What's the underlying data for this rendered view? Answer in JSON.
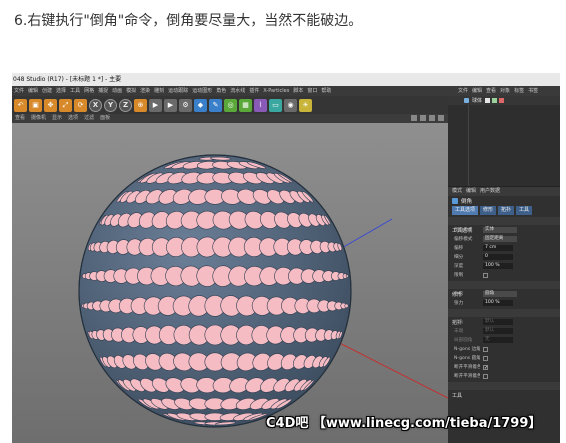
{
  "caption": "6.右键执行\"倒角\"命令，倒角要尽量大，当然不能破边。",
  "window": {
    "title": "048 Studio (R17) - [未标题 1 *] - 主要"
  },
  "menubar": [
    "文件",
    "编辑",
    "创建",
    "选择",
    "工具",
    "网格",
    "捕捉",
    "动画",
    "模拟",
    "渲染",
    "雕刻",
    "运动跟踪",
    "运动图形",
    "角色",
    "流水线",
    "插件",
    "X-Particles",
    "脚本",
    "窗口",
    "帮助"
  ],
  "toolbar": [
    {
      "icon": "undo-icon",
      "glyph": "↶",
      "color": "orange"
    },
    {
      "icon": "live-selection-icon",
      "glyph": "▣",
      "color": "orange"
    },
    {
      "icon": "move-icon",
      "glyph": "✥",
      "color": "orange"
    },
    {
      "icon": "scale-icon",
      "glyph": "⤢",
      "color": "orange"
    },
    {
      "icon": "rotate-icon",
      "glyph": "⟳",
      "color": "orange"
    },
    {
      "icon": "x-axis-icon",
      "glyph": "X",
      "color": "axis"
    },
    {
      "icon": "y-axis-icon",
      "glyph": "Y",
      "color": "axis"
    },
    {
      "icon": "z-axis-icon",
      "glyph": "Z",
      "color": "axis"
    },
    {
      "icon": "coordinate-system-icon",
      "glyph": "⊕",
      "color": "orange"
    },
    {
      "icon": "render-view-icon",
      "glyph": "▶",
      "color": "grey"
    },
    {
      "icon": "render-picture-viewer-icon",
      "glyph": "▶",
      "color": "grey"
    },
    {
      "icon": "render-settings-icon",
      "glyph": "⚙",
      "color": "grey"
    },
    {
      "icon": "cube-icon",
      "glyph": "◆",
      "color": "blue"
    },
    {
      "icon": "pen-icon",
      "glyph": "✎",
      "color": "blue"
    },
    {
      "icon": "subdivision-icon",
      "glyph": "◎",
      "color": "green"
    },
    {
      "icon": "array-icon",
      "glyph": "▦",
      "color": "green"
    },
    {
      "icon": "deformer-icon",
      "glyph": "⌇",
      "color": "purple"
    },
    {
      "icon": "floor-icon",
      "glyph": "▭",
      "color": "teal"
    },
    {
      "icon": "camera-icon",
      "glyph": "◉",
      "color": "grey"
    },
    {
      "icon": "light-icon",
      "glyph": "☀",
      "color": "yellow"
    }
  ],
  "viewport": {
    "menu": [
      "查看",
      "摄像机",
      "显示",
      "选项",
      "过滤",
      "面板"
    ]
  },
  "object_manager": {
    "tabs": [
      "文件",
      "编辑",
      "查看",
      "对象",
      "标签",
      "书签"
    ],
    "object_name": "球体"
  },
  "attributes": {
    "tabs": [
      "模式",
      "编辑",
      "用户数据"
    ],
    "title": "倒角",
    "subtabs": [
      "工具选项",
      "修形",
      "拓扑",
      "工具"
    ],
    "section_tool_options": "工具选项",
    "rows_tool": [
      {
        "label": "倒角模式",
        "value": "实体"
      },
      {
        "label": "偏移模式",
        "value": "固定距离"
      },
      {
        "label": "偏移",
        "value": "7 cm"
      },
      {
        "label": "细分",
        "value": "0"
      },
      {
        "label": "深度",
        "value": "100 %"
      },
      {
        "label": "限制",
        "value": ""
      }
    ],
    "section_shape": "修形",
    "rows_shape": [
      {
        "label": "外形",
        "value": "圆角"
      },
      {
        "label": "张力",
        "value": "100 %"
      }
    ],
    "section_topology": "拓扑",
    "rows_topology": [
      {
        "label": "斜角",
        "value": "默认"
      },
      {
        "label": "末端",
        "value": "默认"
      },
      {
        "label": "局部圆角",
        "value": "无"
      },
      {
        "label": "N-gons 边角",
        "value": ""
      },
      {
        "label": "N-gons 圆角",
        "value": ""
      },
      {
        "label": "断开平滑着色圆角",
        "value": "✓"
      },
      {
        "label": "断开平滑着色斜角",
        "value": ""
      }
    ],
    "section_tool": "工具"
  },
  "watermark": "C4D吧 【www.linecg.com/tieba/1799】",
  "colors": {
    "sphere_face": "#f5bcc4",
    "sphere_edge": "#4f6177",
    "background": "#7a7a7a"
  }
}
